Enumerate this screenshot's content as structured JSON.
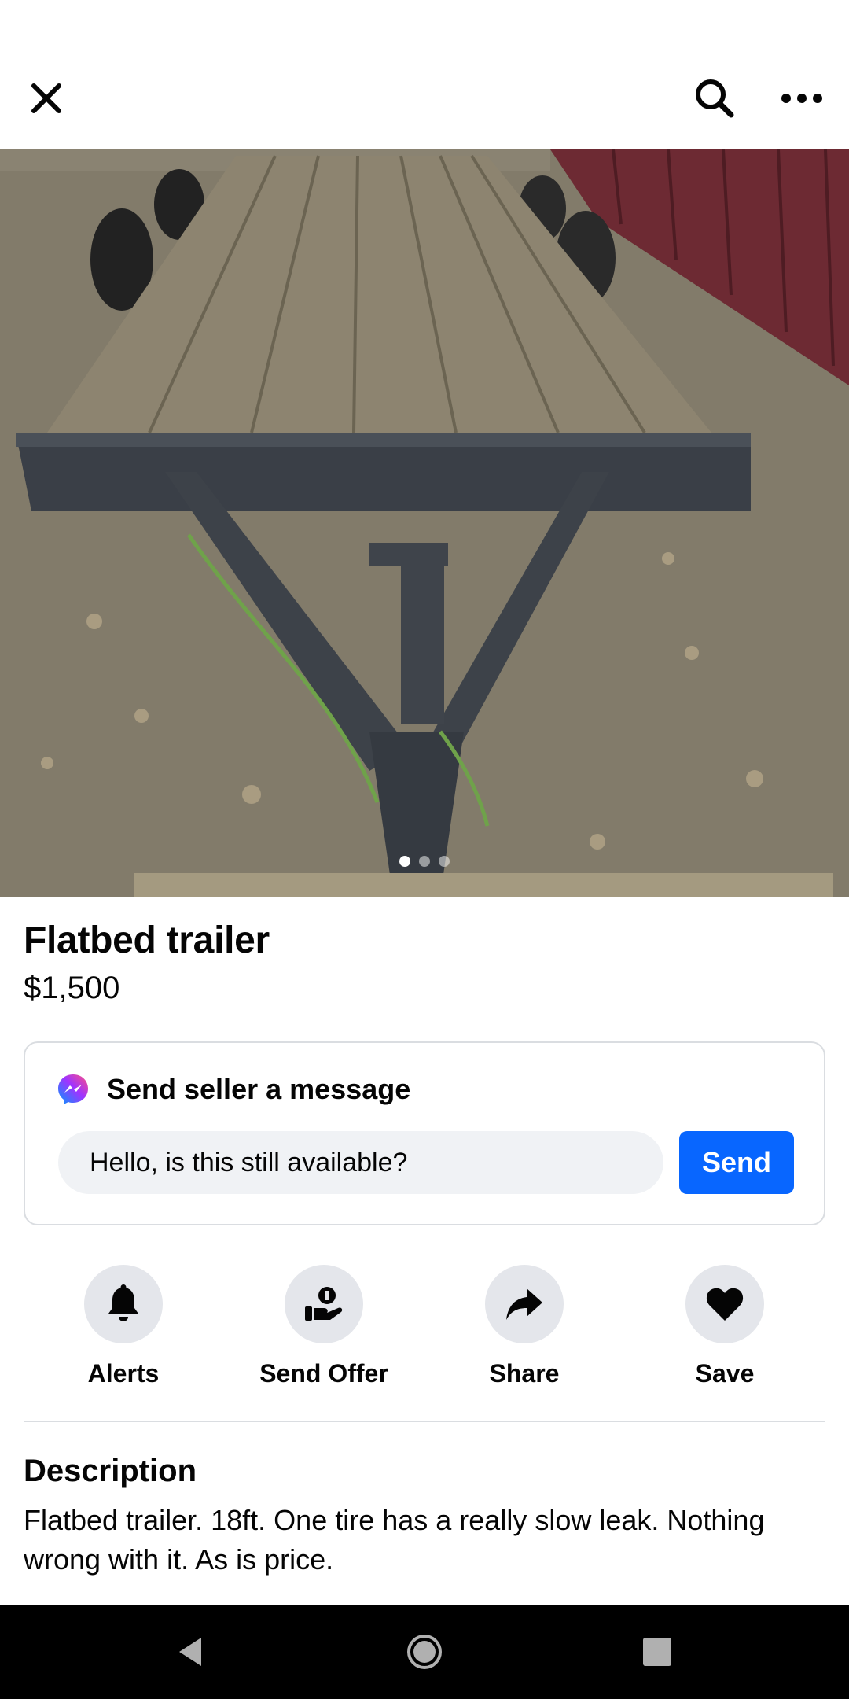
{
  "topbar": {
    "close_icon": "close-icon",
    "search_icon": "search-icon",
    "more_icon": "more-horizontal-icon"
  },
  "listing": {
    "photo_count": 3,
    "photo_index": 1,
    "title": "Flatbed trailer",
    "price": "$1,500"
  },
  "message": {
    "heading": "Send seller a message",
    "input_value": "Hello, is this still available?",
    "send_label": "Send"
  },
  "actions": [
    {
      "label": "Alerts",
      "icon": "bell-icon"
    },
    {
      "label": "Send Offer",
      "icon": "offer-hand-icon"
    },
    {
      "label": "Share",
      "icon": "share-arrow-icon"
    },
    {
      "label": "Save",
      "icon": "heart-icon"
    }
  ],
  "description": {
    "heading": "Description",
    "body": "Flatbed trailer. 18ft. One tire has a really slow leak. Nothing wrong with it. As is price."
  },
  "colors": {
    "accent": "#0866ff",
    "chip_bg": "#f0f2f5",
    "action_bg": "#e4e6eb",
    "divider": "#dadde1"
  }
}
